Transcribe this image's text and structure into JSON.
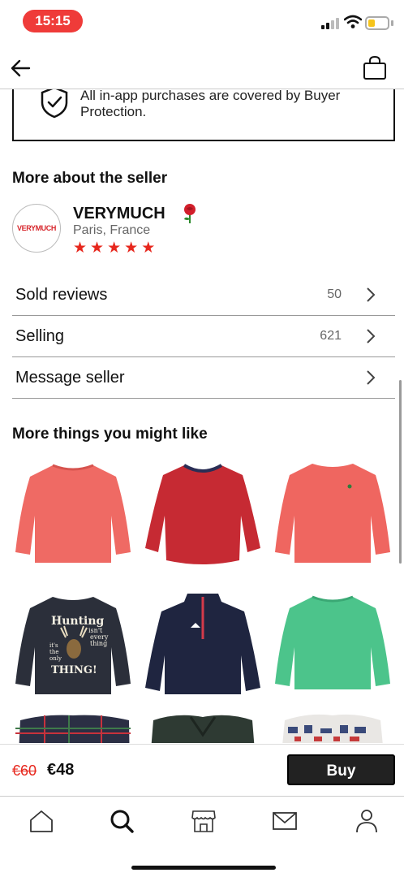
{
  "status_bar": {
    "time": "15:15"
  },
  "protection": {
    "text": "All in-app purchases are covered by Buyer Protection."
  },
  "seller_section": {
    "title": "More about the seller",
    "logo_text": "VERYMUCH",
    "name": "VERYMUCH",
    "location": "Paris, France",
    "rating_stars": 5
  },
  "rows": [
    {
      "label": "Sold reviews",
      "count": "50"
    },
    {
      "label": "Selling",
      "count": "621"
    },
    {
      "label": "Message seller",
      "count": ""
    }
  ],
  "recommend": {
    "title": "More things you might like",
    "items": [
      {
        "name": "sweatshirt",
        "color": "#ef6a64"
      },
      {
        "name": "sweater",
        "color": "#c62a33"
      },
      {
        "name": "sweatshirt",
        "color": "#ef6660"
      },
      {
        "name": "sweatshirt-print",
        "color": "#2b2f3a",
        "print_lines": [
          "Hunting",
          "isn't",
          "every",
          "thing",
          "it's",
          "the",
          "only",
          "THING!"
        ]
      },
      {
        "name": "half-zip-sweater",
        "color": "#1f2540"
      },
      {
        "name": "sweatshirt",
        "color": "#4cc48b"
      },
      {
        "name": "plaid-sweater",
        "color": "#2b2f44"
      },
      {
        "name": "military-sweater",
        "color": "#2e3a33"
      },
      {
        "name": "patterned-sweater",
        "color": "#e9e7e4"
      }
    ]
  },
  "buy_bar": {
    "old_price": "€60",
    "new_price": "€48",
    "buy_label": "Buy"
  },
  "tabs": [
    "home-icon",
    "search-icon",
    "shop-icon",
    "mail-icon",
    "profile-icon"
  ],
  "colors": {
    "accent_red": "#e7271d",
    "status_pill": "#ef3b39",
    "button": "#222222"
  }
}
